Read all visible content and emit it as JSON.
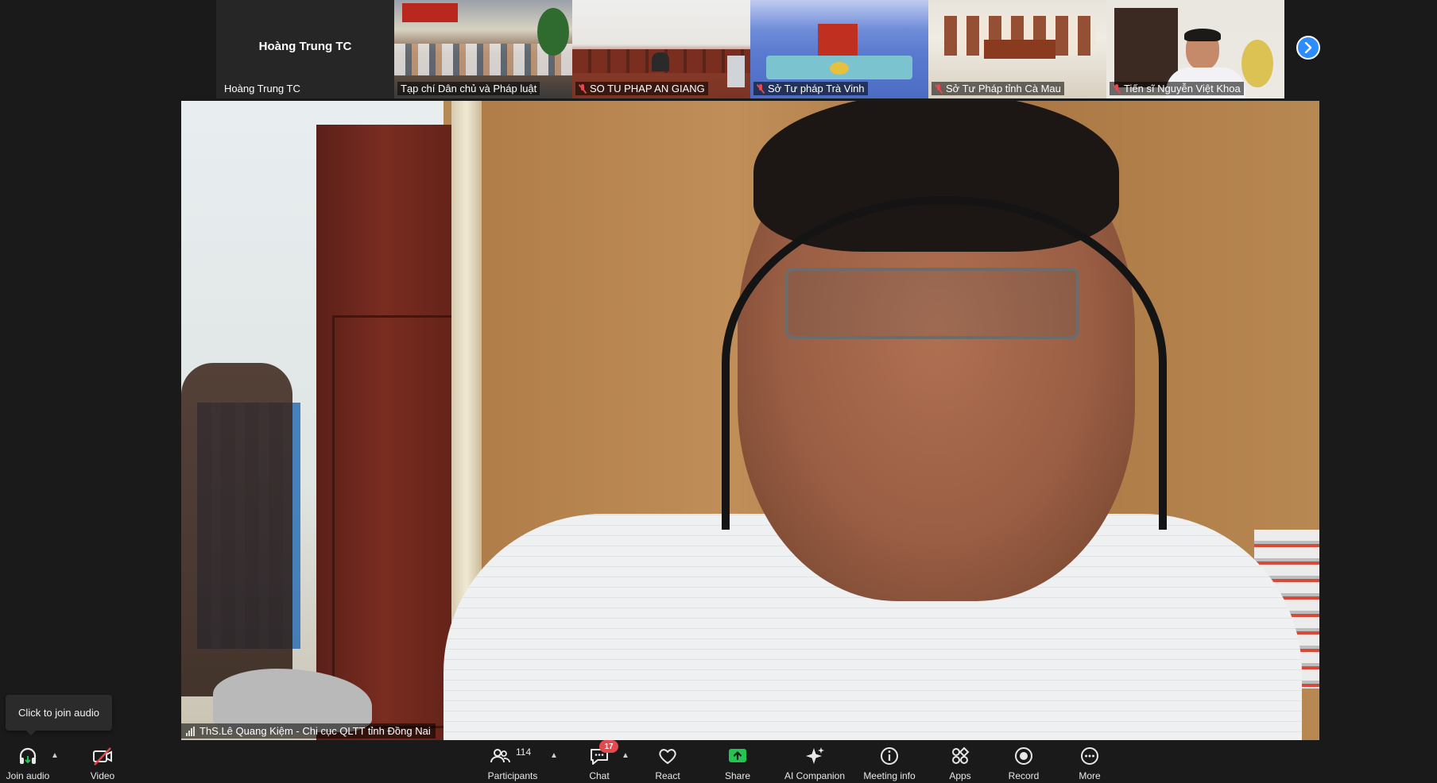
{
  "strip": {
    "tiles": [
      {
        "big_name": "Hoàng Trung TC",
        "label": "Hoàng Trung TC",
        "muted": false
      },
      {
        "label": "Tạp chí Dân chủ và Pháp luật",
        "muted": false
      },
      {
        "label": "SO TU PHAP AN GIANG",
        "muted": true
      },
      {
        "label": "Sở Tư pháp Trà Vinh",
        "muted": true
      },
      {
        "label": "Sở Tư Pháp tỉnh Cà Mau",
        "muted": true
      },
      {
        "label": "Tiến sĩ Nguyễn Việt Khoa",
        "muted": true
      }
    ],
    "next_icon": "chevron-right-icon"
  },
  "speaker": {
    "label": "ThS.Lê Quang Kiệm - Chi cục QLTT tỉnh Đồng Nai"
  },
  "tooltip": {
    "text": "Click to join audio"
  },
  "toolbar": {
    "join_audio": "Join audio",
    "video": "Video",
    "participants": "Participants",
    "participants_count": "114",
    "chat": "Chat",
    "chat_badge": "17",
    "react": "React",
    "share": "Share",
    "ai_companion": "AI Companion",
    "meeting_info": "Meeting info",
    "apps": "Apps",
    "record": "Record",
    "more": "More"
  },
  "colors": {
    "background": "#1a1a1a",
    "accent_blue": "#2d8cff",
    "share_green": "#23c552",
    "alert_red": "#e5484d"
  }
}
